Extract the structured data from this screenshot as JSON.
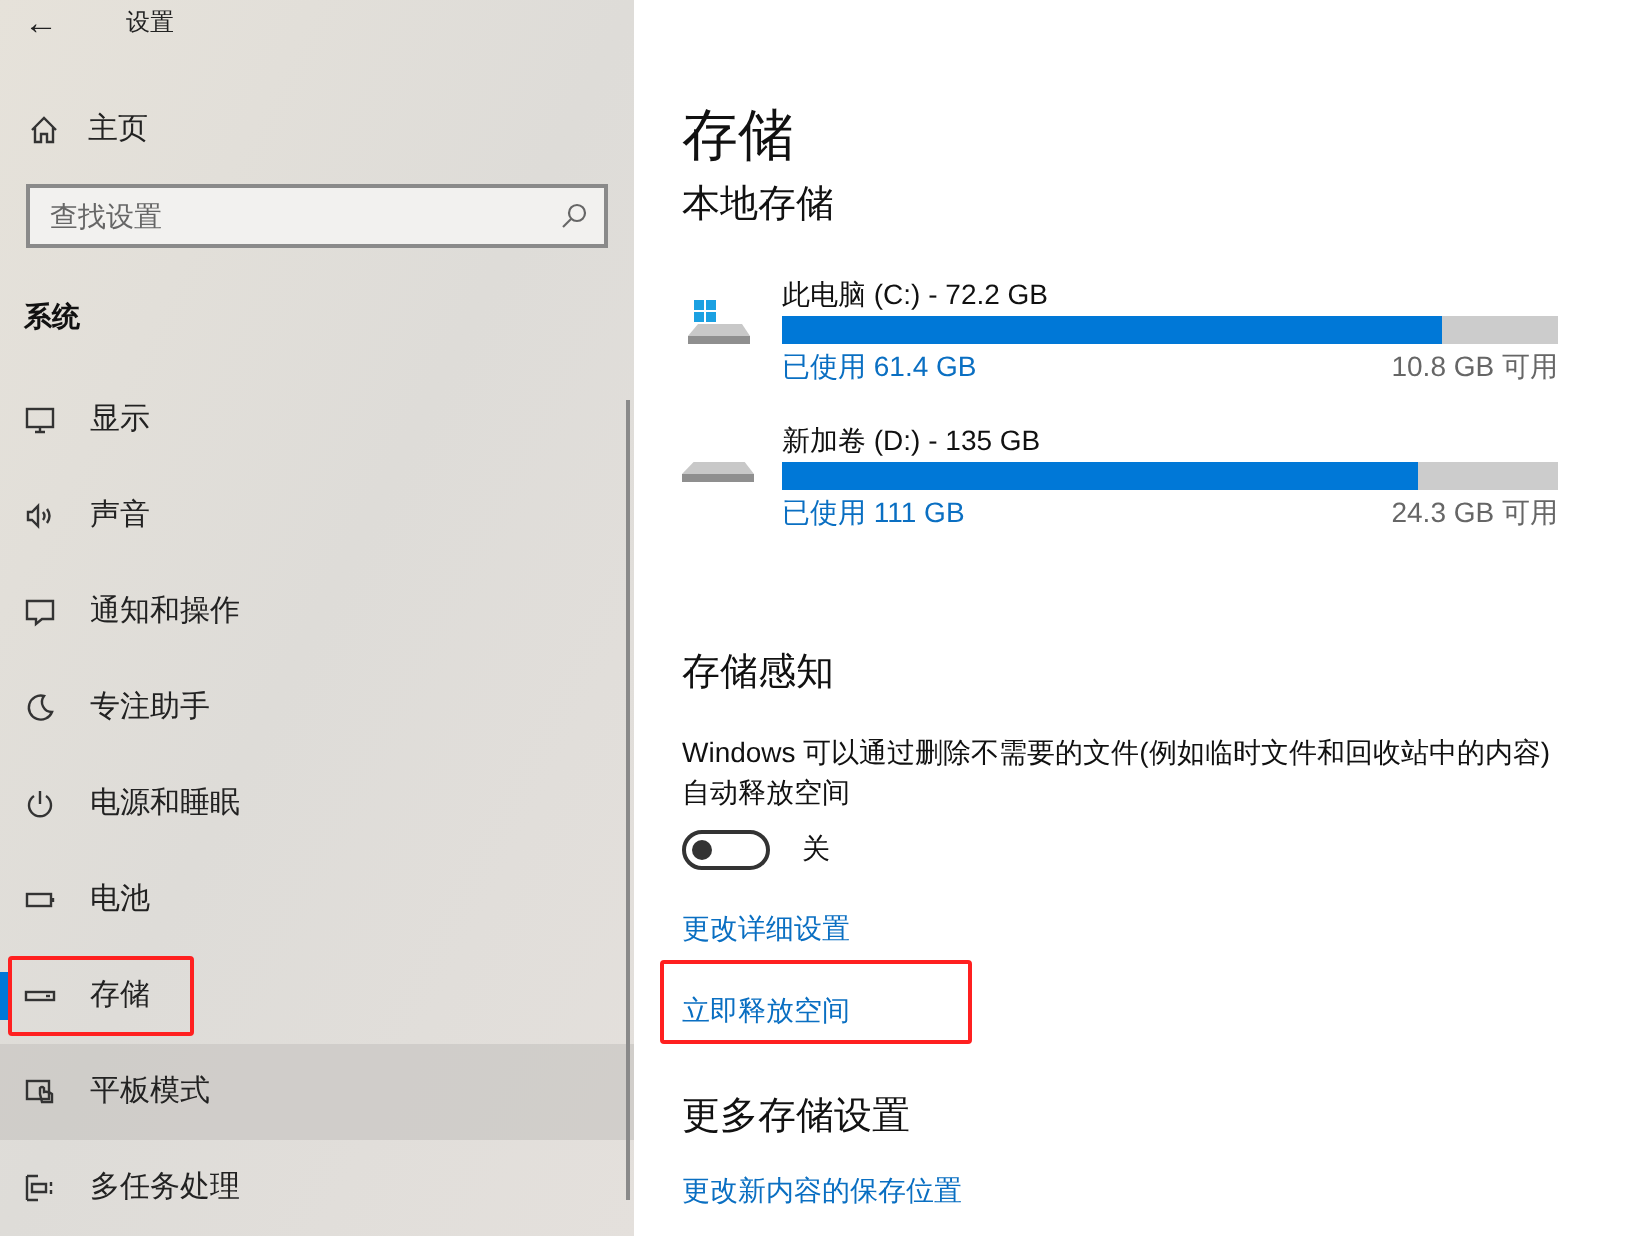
{
  "window": {
    "title": "设置",
    "back": "←"
  },
  "sidebar": {
    "home": "主页",
    "search": {
      "placeholder": "查找设置"
    },
    "section": "系统",
    "items": [
      {
        "kind": "display",
        "label": "显示",
        "selected": false,
        "hovered": false,
        "highlighted": false
      },
      {
        "kind": "sound",
        "label": "声音",
        "selected": false,
        "hovered": false,
        "highlighted": false
      },
      {
        "kind": "notification",
        "label": "通知和操作",
        "selected": false,
        "hovered": false,
        "highlighted": false
      },
      {
        "kind": "focus",
        "label": "专注助手",
        "selected": false,
        "hovered": false,
        "highlighted": false
      },
      {
        "kind": "power",
        "label": "电源和睡眠",
        "selected": false,
        "hovered": false,
        "highlighted": false
      },
      {
        "kind": "battery",
        "label": "电池",
        "selected": false,
        "hovered": false,
        "highlighted": false
      },
      {
        "kind": "storage",
        "label": "存储",
        "selected": true,
        "hovered": false,
        "highlighted": true
      },
      {
        "kind": "tablet",
        "label": "平板模式",
        "selected": false,
        "hovered": true,
        "highlighted": false
      },
      {
        "kind": "multitask",
        "label": "多任务处理",
        "selected": false,
        "hovered": false,
        "highlighted": false
      }
    ]
  },
  "page": {
    "title": "存储",
    "local_heading": "本地存储",
    "drives": [
      {
        "kind": "system",
        "name": "此电脑 (C:) - 72.2 GB",
        "level": 0.85,
        "used": "已使用 61.4 GB",
        "free": "10.8 GB 可用"
      },
      {
        "kind": "data",
        "name": "新加卷 (D:) - 135 GB",
        "level": 0.82,
        "used": "已使用 111 GB",
        "free": "24.3 GB 可用"
      }
    ],
    "sense_heading": "存储感知",
    "sense_text": "Windows 可以通过删除不需要的文件(例如临时文件和回收站中的内容)自动释放空间",
    "toggle": {
      "on": false,
      "label": "关"
    },
    "links": [
      {
        "label": "更改详细设置",
        "highlighted": false
      },
      {
        "label": "立即释放空间",
        "highlighted": true
      }
    ],
    "more_heading": "更多存储设置",
    "more_links": [
      {
        "label": "更改新内容的保存位置"
      }
    ]
  }
}
